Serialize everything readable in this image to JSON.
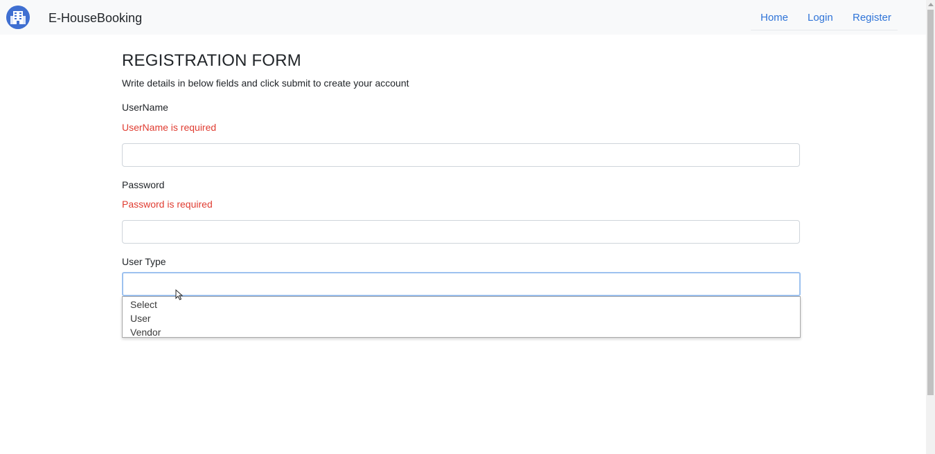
{
  "navbar": {
    "brand": "E-HouseBooking",
    "logo_icon": "building-icon",
    "links": {
      "home": "Home",
      "login": "Login",
      "register": "Register"
    }
  },
  "form": {
    "title": "REGISTRATION FORM",
    "subtitle": "Write details in below fields and click submit to create your account",
    "username": {
      "label": "UserName",
      "error": "UserName is required",
      "value": ""
    },
    "password": {
      "label": "Password",
      "error": "Password is required",
      "value": ""
    },
    "user_type": {
      "label": "User Type",
      "selected": "",
      "options": [
        "Select",
        "User",
        "Vendor"
      ]
    }
  },
  "colors": {
    "link": "#2f74d8",
    "error": "#e03c31",
    "focus_border": "#9cc1ef",
    "navbar_bg": "#f8f9fa",
    "logo_bg": "#3f6fd1"
  }
}
